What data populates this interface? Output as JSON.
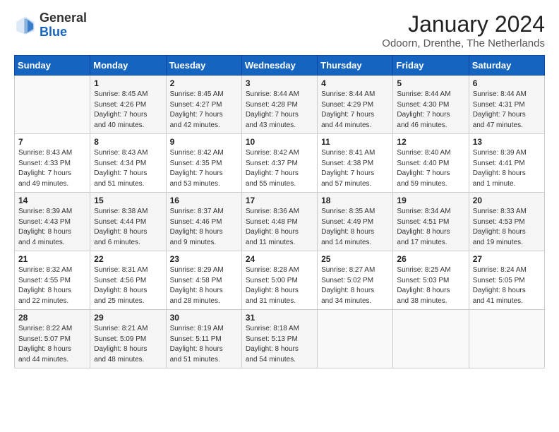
{
  "logo": {
    "general": "General",
    "blue": "Blue"
  },
  "header": {
    "title": "January 2024",
    "subtitle": "Odoorn, Drenthe, The Netherlands"
  },
  "calendar": {
    "days_of_week": [
      "Sunday",
      "Monday",
      "Tuesday",
      "Wednesday",
      "Thursday",
      "Friday",
      "Saturday"
    ],
    "weeks": [
      [
        {
          "day": "",
          "info": ""
        },
        {
          "day": "1",
          "info": "Sunrise: 8:45 AM\nSunset: 4:26 PM\nDaylight: 7 hours\nand 40 minutes."
        },
        {
          "day": "2",
          "info": "Sunrise: 8:45 AM\nSunset: 4:27 PM\nDaylight: 7 hours\nand 42 minutes."
        },
        {
          "day": "3",
          "info": "Sunrise: 8:44 AM\nSunset: 4:28 PM\nDaylight: 7 hours\nand 43 minutes."
        },
        {
          "day": "4",
          "info": "Sunrise: 8:44 AM\nSunset: 4:29 PM\nDaylight: 7 hours\nand 44 minutes."
        },
        {
          "day": "5",
          "info": "Sunrise: 8:44 AM\nSunset: 4:30 PM\nDaylight: 7 hours\nand 46 minutes."
        },
        {
          "day": "6",
          "info": "Sunrise: 8:44 AM\nSunset: 4:31 PM\nDaylight: 7 hours\nand 47 minutes."
        }
      ],
      [
        {
          "day": "7",
          "info": "Sunrise: 8:43 AM\nSunset: 4:33 PM\nDaylight: 7 hours\nand 49 minutes."
        },
        {
          "day": "8",
          "info": "Sunrise: 8:43 AM\nSunset: 4:34 PM\nDaylight: 7 hours\nand 51 minutes."
        },
        {
          "day": "9",
          "info": "Sunrise: 8:42 AM\nSunset: 4:35 PM\nDaylight: 7 hours\nand 53 minutes."
        },
        {
          "day": "10",
          "info": "Sunrise: 8:42 AM\nSunset: 4:37 PM\nDaylight: 7 hours\nand 55 minutes."
        },
        {
          "day": "11",
          "info": "Sunrise: 8:41 AM\nSunset: 4:38 PM\nDaylight: 7 hours\nand 57 minutes."
        },
        {
          "day": "12",
          "info": "Sunrise: 8:40 AM\nSunset: 4:40 PM\nDaylight: 7 hours\nand 59 minutes."
        },
        {
          "day": "13",
          "info": "Sunrise: 8:39 AM\nSunset: 4:41 PM\nDaylight: 8 hours\nand 1 minute."
        }
      ],
      [
        {
          "day": "14",
          "info": "Sunrise: 8:39 AM\nSunset: 4:43 PM\nDaylight: 8 hours\nand 4 minutes."
        },
        {
          "day": "15",
          "info": "Sunrise: 8:38 AM\nSunset: 4:44 PM\nDaylight: 8 hours\nand 6 minutes."
        },
        {
          "day": "16",
          "info": "Sunrise: 8:37 AM\nSunset: 4:46 PM\nDaylight: 8 hours\nand 9 minutes."
        },
        {
          "day": "17",
          "info": "Sunrise: 8:36 AM\nSunset: 4:48 PM\nDaylight: 8 hours\nand 11 minutes."
        },
        {
          "day": "18",
          "info": "Sunrise: 8:35 AM\nSunset: 4:49 PM\nDaylight: 8 hours\nand 14 minutes."
        },
        {
          "day": "19",
          "info": "Sunrise: 8:34 AM\nSunset: 4:51 PM\nDaylight: 8 hours\nand 17 minutes."
        },
        {
          "day": "20",
          "info": "Sunrise: 8:33 AM\nSunset: 4:53 PM\nDaylight: 8 hours\nand 19 minutes."
        }
      ],
      [
        {
          "day": "21",
          "info": "Sunrise: 8:32 AM\nSunset: 4:55 PM\nDaylight: 8 hours\nand 22 minutes."
        },
        {
          "day": "22",
          "info": "Sunrise: 8:31 AM\nSunset: 4:56 PM\nDaylight: 8 hours\nand 25 minutes."
        },
        {
          "day": "23",
          "info": "Sunrise: 8:29 AM\nSunset: 4:58 PM\nDaylight: 8 hours\nand 28 minutes."
        },
        {
          "day": "24",
          "info": "Sunrise: 8:28 AM\nSunset: 5:00 PM\nDaylight: 8 hours\nand 31 minutes."
        },
        {
          "day": "25",
          "info": "Sunrise: 8:27 AM\nSunset: 5:02 PM\nDaylight: 8 hours\nand 34 minutes."
        },
        {
          "day": "26",
          "info": "Sunrise: 8:25 AM\nSunset: 5:03 PM\nDaylight: 8 hours\nand 38 minutes."
        },
        {
          "day": "27",
          "info": "Sunrise: 8:24 AM\nSunset: 5:05 PM\nDaylight: 8 hours\nand 41 minutes."
        }
      ],
      [
        {
          "day": "28",
          "info": "Sunrise: 8:22 AM\nSunset: 5:07 PM\nDaylight: 8 hours\nand 44 minutes."
        },
        {
          "day": "29",
          "info": "Sunrise: 8:21 AM\nSunset: 5:09 PM\nDaylight: 8 hours\nand 48 minutes."
        },
        {
          "day": "30",
          "info": "Sunrise: 8:19 AM\nSunset: 5:11 PM\nDaylight: 8 hours\nand 51 minutes."
        },
        {
          "day": "31",
          "info": "Sunrise: 8:18 AM\nSunset: 5:13 PM\nDaylight: 8 hours\nand 54 minutes."
        },
        {
          "day": "",
          "info": ""
        },
        {
          "day": "",
          "info": ""
        },
        {
          "day": "",
          "info": ""
        }
      ]
    ]
  }
}
